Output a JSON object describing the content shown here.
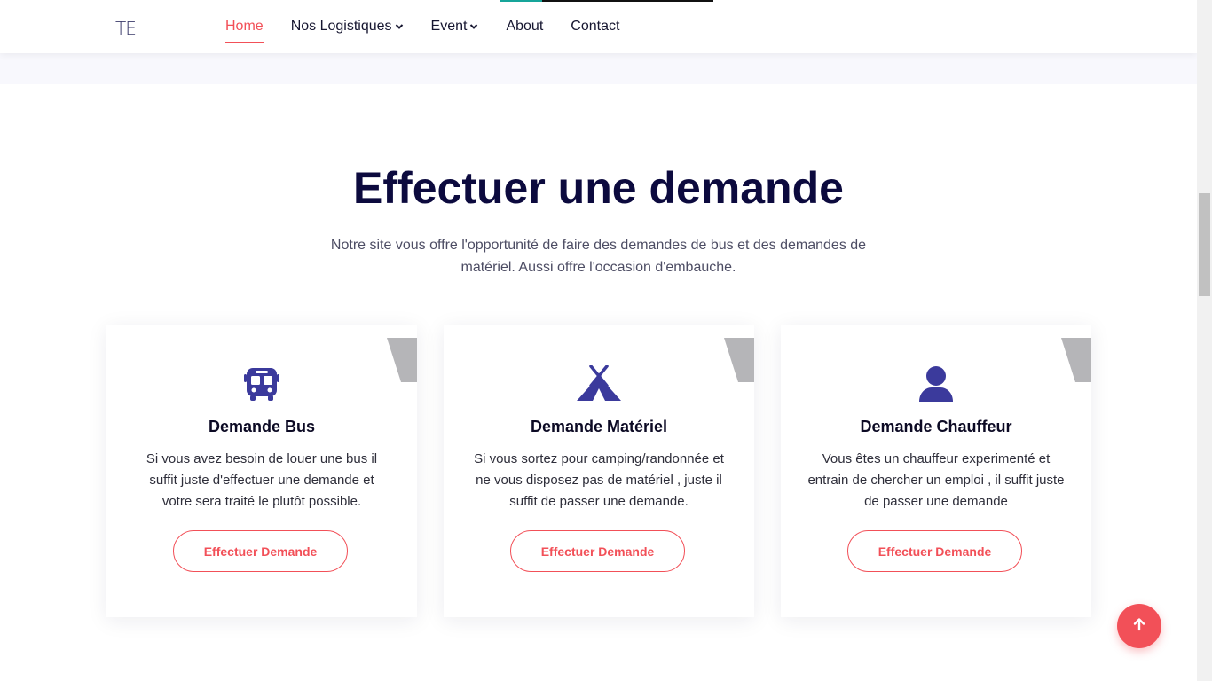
{
  "header": {
    "logo": "TE",
    "nav": [
      {
        "label": "Home",
        "active": true,
        "dropdown": false
      },
      {
        "label": "Nos Logistiques",
        "active": false,
        "dropdown": true
      },
      {
        "label": "Event",
        "active": false,
        "dropdown": true
      },
      {
        "label": "About",
        "active": false,
        "dropdown": false
      },
      {
        "label": "Contact",
        "active": false,
        "dropdown": false
      }
    ]
  },
  "section": {
    "title": "Effectuer une demande",
    "subtitle": "Notre site vous offre l'opportunité de faire des demandes de bus et des demandes de matériel. Aussi offre l'occasion d'embauche.",
    "cards": [
      {
        "icon": "bus-icon",
        "title": "Demande Bus",
        "text": "Si vous avez besoin de louer une bus il suffit juste d'effectuer une demande et votre sera traité le plutôt possible.",
        "button": "Effectuer Demande"
      },
      {
        "icon": "tent-icon",
        "title": "Demande Matériel",
        "text": "Si vous sortez pour camping/randonnée et ne vous disposez pas de matériel , juste il suffit de passer une demande.",
        "button": "Effectuer Demande"
      },
      {
        "icon": "user-icon",
        "title": "Demande Chauffeur",
        "text": "Vous êtes un chauffeur experimenté et entrain de chercher un emploi , il suffit juste de passer une demande",
        "button": "Effectuer Demande"
      }
    ]
  },
  "colors": {
    "accent": "#f25058",
    "icon": "#3b3a9c",
    "heading": "#0c0a3e"
  }
}
